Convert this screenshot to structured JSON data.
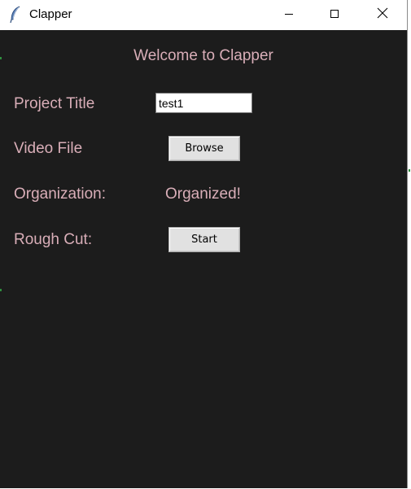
{
  "window": {
    "title": "Clapper",
    "icon": "feather-icon",
    "controls": [
      "minimize-icon",
      "maximize-icon",
      "close-icon"
    ]
  },
  "main": {
    "welcome": "Welcome to Clapper",
    "project_title_label": "Project Title",
    "project_title_value": "test1",
    "video_file_label": "Video File",
    "browse_label": "Browse",
    "organization_label": "Organization:",
    "organization_status": "Organized!",
    "rough_cut_label": "Rough Cut:",
    "start_label": "Start"
  },
  "colors": {
    "background": "#1c1c1c",
    "label_text": "#d9aeb8",
    "button_face": "#e1e1e1"
  }
}
